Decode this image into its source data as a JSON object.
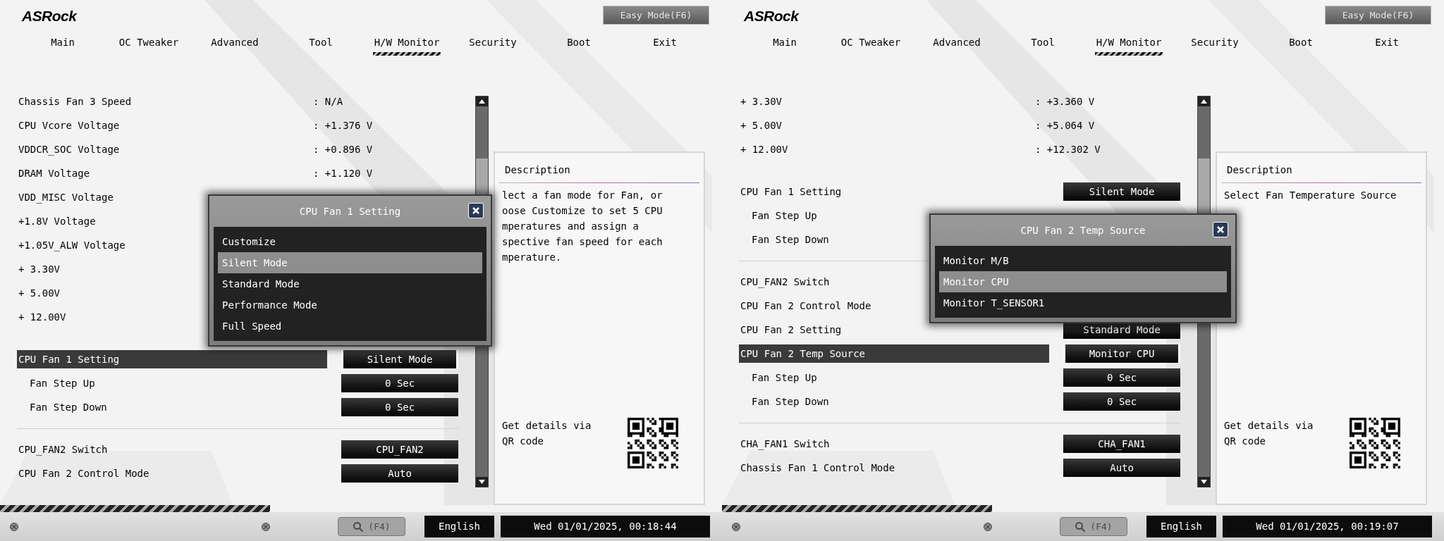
{
  "screens": [
    {
      "logo": "ASRock",
      "easy_mode_button": "Easy Mode(F6)",
      "tabs": [
        {
          "label": "Main",
          "selected": false
        },
        {
          "label": "OC Tweaker",
          "selected": false
        },
        {
          "label": "Advanced",
          "selected": false
        },
        {
          "label": "Tool",
          "selected": false
        },
        {
          "label": "H/W Monitor",
          "selected": true
        },
        {
          "label": "Security",
          "selected": false
        },
        {
          "label": "Boot",
          "selected": false
        },
        {
          "label": "Exit",
          "selected": false
        }
      ],
      "groups": [
        {
          "kind": "readings",
          "rows": [
            {
              "label": "Chassis Fan 3 Speed",
              "value": ": N/A",
              "selected": false
            },
            {
              "label": "CPU Vcore Voltage",
              "value": ": +1.376 V",
              "selected": false
            },
            {
              "label": "VDDCR_SOC Voltage",
              "value": ": +0.896 V",
              "selected": false
            },
            {
              "label": "DRAM Voltage",
              "value": ": +1.120 V",
              "selected": false
            },
            {
              "label": "VDD_MISC Voltage",
              "selected": false
            },
            {
              "label": "+1.8V Voltage",
              "selected": false
            },
            {
              "label": "+1.05V_ALW Voltage",
              "selected": false
            },
            {
              "label": "+ 3.30V",
              "selected": false
            },
            {
              "label": "+ 5.00V",
              "selected": false
            },
            {
              "label": "+ 12.00V",
              "selected": false
            }
          ]
        },
        {
          "kind": "settings",
          "rows": [
            {
              "label": "CPU Fan 1 Setting",
              "value": "Silent Mode",
              "selected": true,
              "children": [
                {
                  "label": "Fan Step Up",
                  "value": "0 Sec",
                  "selected": false
                },
                {
                  "label": "Fan Step Down",
                  "value": "0 Sec",
                  "selected": false
                }
              ]
            }
          ]
        },
        {
          "kind": "settings",
          "rows": [
            {
              "label": "CPU_FAN2 Switch",
              "value": "CPU_FAN2",
              "selected": false
            },
            {
              "label": "CPU Fan 2 Control Mode",
              "value": "Auto",
              "selected": false
            }
          ]
        }
      ],
      "popup": {
        "title": "CPU Fan 1 Setting",
        "options": [
          {
            "label": "Customize",
            "selected": false
          },
          {
            "label": "Silent Mode",
            "selected": true
          },
          {
            "label": "Standard Mode",
            "selected": false
          },
          {
            "label": "Performance Mode",
            "selected": false
          },
          {
            "label": "Full Speed",
            "selected": false
          }
        ]
      },
      "description": {
        "title": "Description",
        "lines": [
          "lect a fan mode for Fan, or",
          "oose Customize to set 5 CPU",
          "mperatures and assign a",
          "spective fan speed for each",
          "mperature."
        ],
        "qr_text": "Get details via QR code"
      },
      "footer": {
        "search_button": {
          "label": "(F4)",
          "disabled": true
        },
        "language": "English",
        "datetime": "Wed 01/01/2025, 00:18:44"
      }
    },
    {
      "logo": "ASRock",
      "easy_mode_button": "Easy Mode(F6)",
      "tabs": [
        {
          "label": "Main",
          "selected": false
        },
        {
          "label": "OC Tweaker",
          "selected": false
        },
        {
          "label": "Advanced",
          "selected": false
        },
        {
          "label": "Tool",
          "selected": false
        },
        {
          "label": "H/W Monitor",
          "selected": true
        },
        {
          "label": "Security",
          "selected": false
        },
        {
          "label": "Boot",
          "selected": false
        },
        {
          "label": "Exit",
          "selected": false
        }
      ],
      "groups": [
        {
          "kind": "readings",
          "rows": [
            {
              "label": "+ 3.30V",
              "value": ": +3.360 V",
              "selected": false
            },
            {
              "label": "+ 5.00V",
              "value": ": +5.064 V",
              "selected": false
            },
            {
              "label": "+ 12.00V",
              "value": ": +12.302 V",
              "selected": false
            }
          ]
        },
        {
          "kind": "settings",
          "rows": [
            {
              "label": "CPU Fan 1 Setting",
              "value": "Silent Mode",
              "selected": false,
              "children": [
                {
                  "label": "Fan Step Up",
                  "selected": false
                },
                {
                  "label": "Fan Step Down",
                  "selected": false
                }
              ]
            }
          ]
        },
        {
          "kind": "settings",
          "rows": [
            {
              "label": "CPU_FAN2 Switch",
              "selected": false
            },
            {
              "label": "CPU Fan 2 Control Mode",
              "selected": false
            },
            {
              "label": "CPU Fan 2 Setting",
              "value": "Standard Mode",
              "selected": false
            },
            {
              "label": "CPU Fan 2 Temp Source",
              "value": "Monitor CPU",
              "selected": true,
              "children": [
                {
                  "label": "Fan Step Up",
                  "value": "0 Sec",
                  "selected": false
                },
                {
                  "label": "Fan Step Down",
                  "value": "0 Sec",
                  "selected": false
                }
              ]
            }
          ]
        },
        {
          "kind": "settings",
          "rows": [
            {
              "label": "CHA_FAN1 Switch",
              "value": "CHA_FAN1",
              "selected": false
            },
            {
              "label": "Chassis Fan 1 Control Mode",
              "value": "Auto",
              "selected": false
            }
          ]
        }
      ],
      "popup": {
        "title": "CPU Fan 2 Temp Source",
        "options": [
          {
            "label": "Monitor M/B",
            "selected": false
          },
          {
            "label": "Monitor CPU",
            "selected": true
          },
          {
            "label": "Monitor T_SENSOR1",
            "selected": false
          }
        ]
      },
      "description": {
        "title": "Description",
        "lines": [
          "Select Fan Temperature Source"
        ],
        "qr_text": "Get details via QR code"
      },
      "footer": {
        "search_button": {
          "label": "(F4)",
          "disabled": true
        },
        "language": "English",
        "datetime": "Wed 01/01/2025, 00:19:07"
      }
    }
  ]
}
